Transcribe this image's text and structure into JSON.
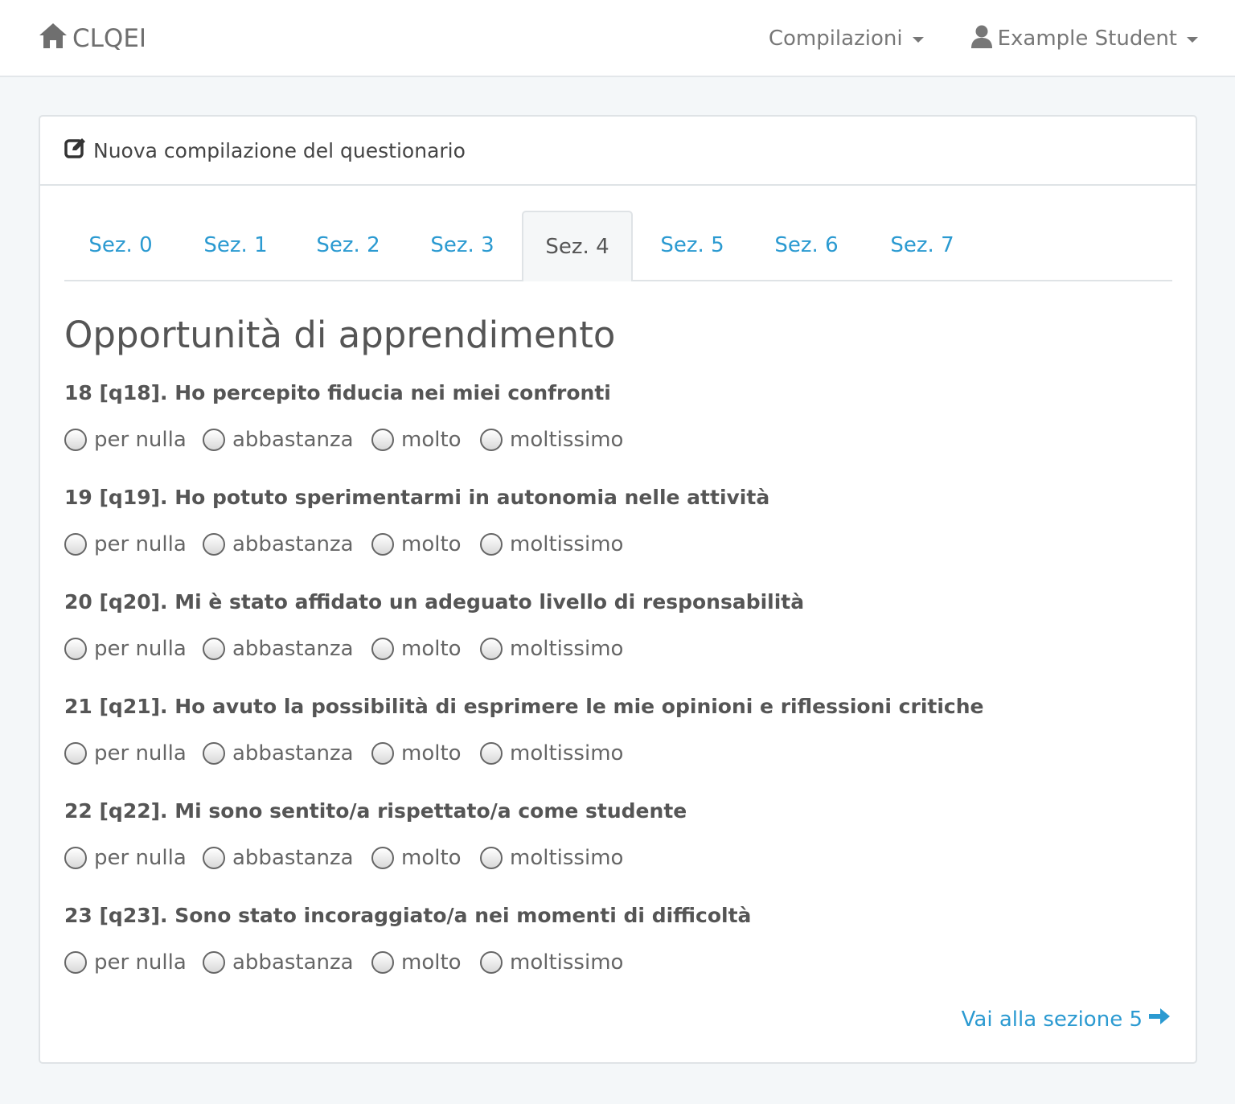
{
  "navbar": {
    "brand": "CLQEI",
    "compilazioni_label": "Compilazioni",
    "user_label": "Example Student"
  },
  "panel": {
    "heading": "Nuova compilazione del questionario"
  },
  "tabs": [
    {
      "label": "Sez. 0",
      "active": false
    },
    {
      "label": "Sez. 1",
      "active": false
    },
    {
      "label": "Sez. 2",
      "active": false
    },
    {
      "label": "Sez. 3",
      "active": false
    },
    {
      "label": "Sez. 4",
      "active": true
    },
    {
      "label": "Sez. 5",
      "active": false
    },
    {
      "label": "Sez. 6",
      "active": false
    },
    {
      "label": "Sez. 7",
      "active": false
    }
  ],
  "section_title": "Opportunità di apprendimento",
  "options": [
    "per nulla",
    "abbastanza",
    "molto",
    "moltissimo"
  ],
  "questions": [
    {
      "label": "18 [q18]. Ho percepito fiducia nei miei confronti",
      "selected": null
    },
    {
      "label": "19 [q19]. Ho potuto sperimentarmi in autonomia nelle attività",
      "selected": null
    },
    {
      "label": "20 [q20]. Mi è stato affidato un adeguato livello di responsabilità",
      "selected": null
    },
    {
      "label": "21 [q21]. Ho avuto la possibilità di esprimere le mie opinioni e riflessioni critiche",
      "selected": null
    },
    {
      "label": "22 [q22]. Mi sono sentito/a rispettato/a come studente",
      "selected": null
    },
    {
      "label": "23 [q23]. Sono stato incoraggiato/a nei momenti di difficoltà",
      "selected": null
    }
  ],
  "next_link": "Vai alla sezione 5",
  "colors": {
    "link": "#2b9ad1",
    "background": "#f4f7f9",
    "text": "#555555"
  },
  "icons": {
    "brand": "home-icon",
    "user": "user-icon",
    "heading": "edit-icon",
    "next": "arrow-right-icon"
  }
}
